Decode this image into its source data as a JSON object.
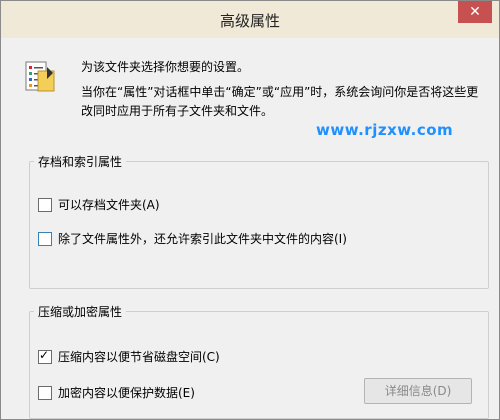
{
  "window": {
    "title": "高级属性",
    "close_label": "✕"
  },
  "intro": {
    "line1": "为该文件夹选择你想要的设置。",
    "line2": "当你在“属性”对话框中单击“确定”或“应用”时，系统会询问你是否将这些更改同时应用于所有子文件夹和文件。"
  },
  "watermark": "www.rjzxw.com",
  "archive_index": {
    "label": "存档和索引属性",
    "archive": {
      "label": "可以存档文件夹(A)",
      "checked": false
    },
    "index": {
      "label": "除了文件属性外，还允许索引此文件夹中文件的内容(I)",
      "checked": false
    }
  },
  "compress_encrypt": {
    "label": "压缩或加密属性",
    "compress": {
      "label": "压缩内容以便节省磁盘空间(C)",
      "checked": true
    },
    "encrypt": {
      "label": "加密内容以便保护数据(E)",
      "checked": false
    },
    "details_label": "详细信息(D)"
  },
  "colors": {
    "title_bar": "#f0e9d8",
    "close": "#c75050",
    "watermark": "#1e90ff"
  }
}
